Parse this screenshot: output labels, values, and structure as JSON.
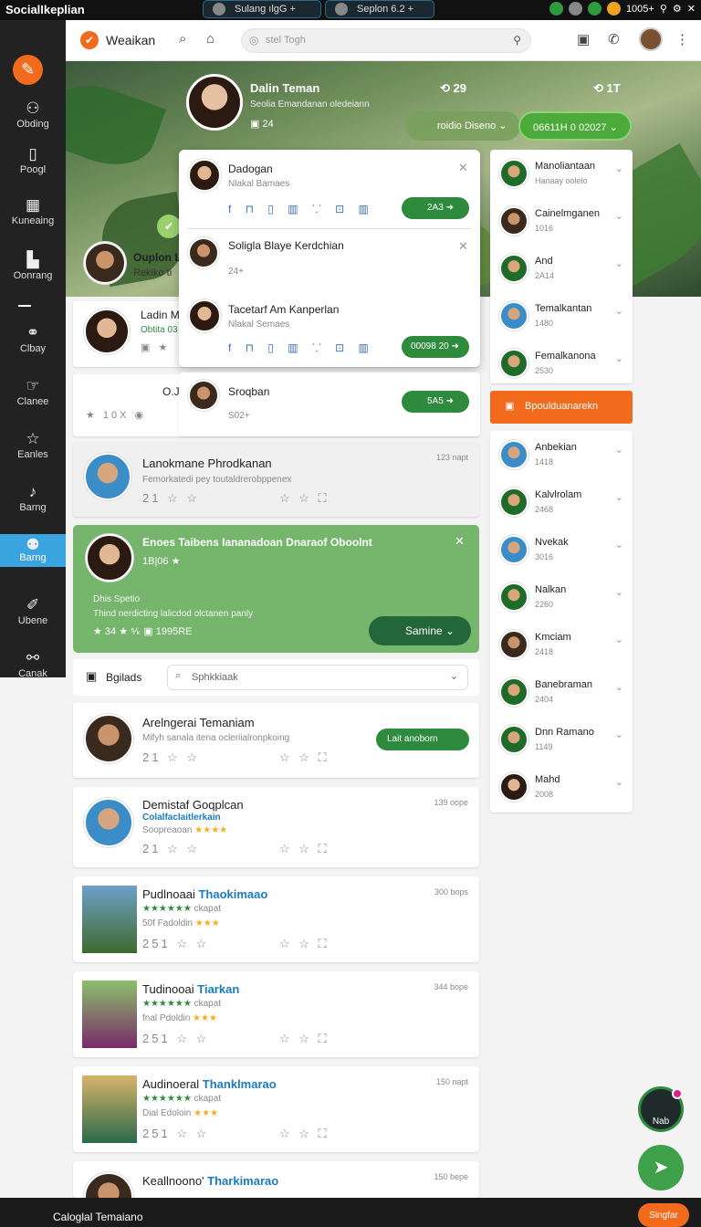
{
  "topbar": {
    "brand": "SocialIkeplian",
    "tab1": "Sulang ılgG +",
    "tab2": "Seplon 6.2 +",
    "count": "1005+"
  },
  "sidebar": {
    "items": [
      {
        "label": "Obding",
        "icon": "bell-icon"
      },
      {
        "label": "Poogl",
        "icon": "page-icon"
      },
      {
        "label": "Kuneaing",
        "icon": "grid-icon"
      },
      {
        "label": "Oonrang",
        "icon": "chart-icon"
      },
      {
        "label": "Clbay",
        "icon": "group-icon"
      },
      {
        "label": "Clanee",
        "icon": "hand-icon"
      },
      {
        "label": "Eanles",
        "icon": "star-icon"
      },
      {
        "label": "Barng",
        "icon": "music-icon"
      },
      {
        "label": "Barng",
        "icon": "people-icon"
      },
      {
        "label": "Ubene",
        "icon": "pen-icon"
      },
      {
        "label": "Canak",
        "icon": "users-icon"
      }
    ]
  },
  "header": {
    "title": "Weaikan",
    "search_placeholder": "stel Togh"
  },
  "hero": {
    "name": "Dalin Teman",
    "subtitle": "Seolia Emandanan oledeiann",
    "stat1": "29",
    "stat2": "1T",
    "meta": "24",
    "btn1": "roidio Diseno",
    "btn2": "06611H 0 02027",
    "side_name": "Ouplon L",
    "side_sub": "Rekiko ti"
  },
  "dropdown": {
    "items": [
      {
        "name": "Dadogan",
        "sub": "Nlakal Bamaes",
        "pill": "2A3"
      },
      {
        "name": "Soligla Blaye Kerdchian",
        "sub": "24+"
      },
      {
        "name": "Tacetarf Am Kanperlan",
        "sub": "Nlakal Semaes",
        "pill": "00098 20"
      },
      {
        "name": "Sroqban",
        "sub": "S02+",
        "pill": "5A5"
      }
    ]
  },
  "partial": {
    "name1": "Ladin M",
    "sub1": "Obtita 03",
    "label2": "O.J",
    "count2": "10X"
  },
  "post1": {
    "name": "Lanokmane Phrodkanan",
    "sub": "Femorkatedi pey toutaldrerobppenex",
    "time": "123 napt",
    "meta": "21"
  },
  "promo": {
    "title": "Enoes Taibens Iananadoan Dnaraof Oboolnt",
    "sub": "1B|06",
    "line1": "Dhis Spetio",
    "line2": "Thind nerdicting lalicdod olctanen panly",
    "meta1": "34",
    "meta2": "1995RE",
    "button": "Samine"
  },
  "toolbar": {
    "label": "Bgilads",
    "select": "Sphkkiaak"
  },
  "cards": [
    {
      "name": "Arelngerai Temaniam",
      "sub": "Mifyh sanala itena ocleriialronpkoing",
      "meta": "21",
      "button": "Lait anoborn",
      "time": ""
    },
    {
      "name": "Demistaf Goqplcan",
      "sub2": "Colalfaclaitlerkain",
      "sub": "Soopreaoan",
      "meta": "21",
      "time": "139 oope",
      "button": ""
    },
    {
      "name": "Pudlnoaai",
      "hl": "Thaokimaao",
      "sub2": "ckapat",
      "sub": "50f Fadoldin",
      "meta": "251",
      "time": "300 bops",
      "button": ""
    },
    {
      "name": "Tudinooai",
      "hl": "Tiarkan",
      "sub2": "ckapat",
      "sub": "fnal Pdoldin",
      "meta": "251",
      "time": "344 bope",
      "button": ""
    },
    {
      "name": "Audinoeral",
      "hl": "Thanklmarao",
      "sub2": "ckapat",
      "sub": "Dial Edoloin",
      "meta": "251",
      "time": "150 napt",
      "button": ""
    },
    {
      "name": "Keallnoono'",
      "hl": "Tharkimarao",
      "sub2": "",
      "sub": "",
      "meta": "",
      "time": "150 bepe",
      "button": ""
    }
  ],
  "right_top": [
    {
      "name": "Manoliantaan",
      "sub": "Hanaay oolelo"
    },
    {
      "name": "Cainelmganen",
      "sub": "1016"
    },
    {
      "name": "And",
      "sub": "2A14"
    },
    {
      "name": "Temalkantan",
      "sub": "1480"
    },
    {
      "name": "Femalkanona",
      "sub": "2530"
    }
  ],
  "orange_button": "Bpoulduanarekn",
  "right_bottom": [
    {
      "name": "Anbekian",
      "sub": "1418"
    },
    {
      "name": "Kalvlrolam",
      "sub": "2468"
    },
    {
      "name": "Nvekak",
      "sub": "3016"
    },
    {
      "name": "Nalkan",
      "sub": "2260"
    },
    {
      "name": "Kmciam",
      "sub": "2418"
    },
    {
      "name": "Banebraman",
      "sub": "2404"
    },
    {
      "name": "Dnn Ramano",
      "sub": "1149"
    },
    {
      "name": "Mahd",
      "sub": "2008"
    }
  ],
  "fab": {
    "label": "Nab"
  },
  "bottom": {
    "name": "Caloglal Temaiano",
    "button": "Singfar"
  }
}
